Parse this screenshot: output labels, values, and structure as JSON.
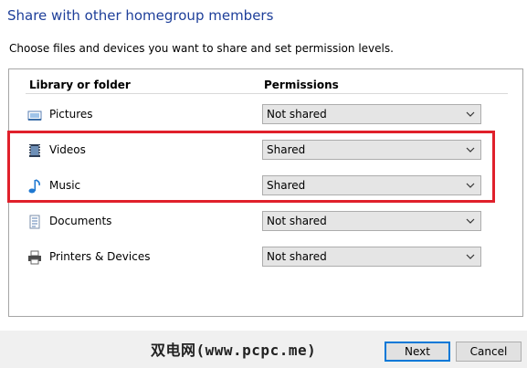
{
  "dialog": {
    "title": "Share with other homegroup members",
    "instruction": "Choose files and devices you want to share and set permission levels."
  },
  "table": {
    "col_library": "Library or folder",
    "col_permissions": "Permissions",
    "rows": [
      {
        "name": "Pictures",
        "icon": "pictures-icon",
        "permission": "Not shared"
      },
      {
        "name": "Videos",
        "icon": "videos-icon",
        "permission": "Shared"
      },
      {
        "name": "Music",
        "icon": "music-icon",
        "permission": "Shared"
      },
      {
        "name": "Documents",
        "icon": "documents-icon",
        "permission": "Not shared"
      },
      {
        "name": "Printers & Devices",
        "icon": "printer-icon",
        "permission": "Not shared"
      }
    ]
  },
  "buttons": {
    "next": "Next",
    "cancel": "Cancel"
  },
  "watermark": "双电网(www.pcpc.me)",
  "colors": {
    "title": "#1e3f9a",
    "highlight": "#e0202b",
    "select_bg": "#e5e5e5",
    "footer_bg": "#f0f0f0"
  }
}
